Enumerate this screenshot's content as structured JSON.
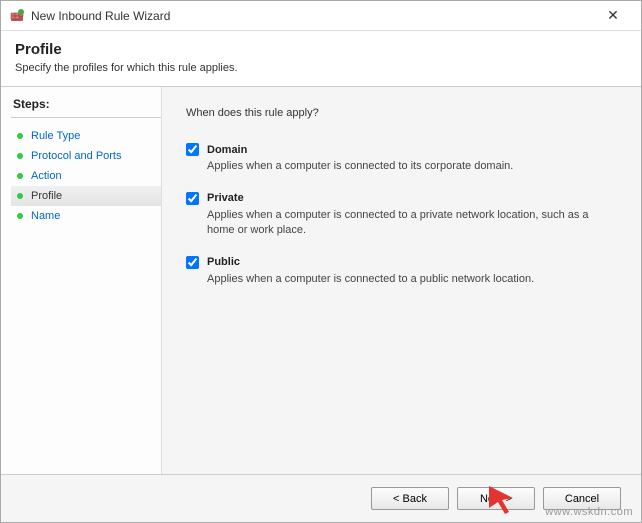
{
  "window": {
    "title": "New Inbound Rule Wizard",
    "close_label": "✕"
  },
  "header": {
    "title": "Profile",
    "subtitle": "Specify the profiles for which this rule applies."
  },
  "steps": {
    "title": "Steps:",
    "items": [
      {
        "label": "Rule Type",
        "current": false
      },
      {
        "label": "Protocol and Ports",
        "current": false
      },
      {
        "label": "Action",
        "current": false
      },
      {
        "label": "Profile",
        "current": true
      },
      {
        "label": "Name",
        "current": false
      }
    ]
  },
  "content": {
    "question": "When does this rule apply?",
    "options": [
      {
        "label": "Domain",
        "checked": true,
        "desc": "Applies when a computer is connected to its corporate domain."
      },
      {
        "label": "Private",
        "checked": true,
        "desc": "Applies when a computer is connected to a private network location, such as a home or work place."
      },
      {
        "label": "Public",
        "checked": true,
        "desc": "Applies when a computer is connected to a public network location."
      }
    ]
  },
  "footer": {
    "back": "< Back",
    "next": "Next >",
    "cancel": "Cancel"
  },
  "watermark": "www.wskdn.com"
}
